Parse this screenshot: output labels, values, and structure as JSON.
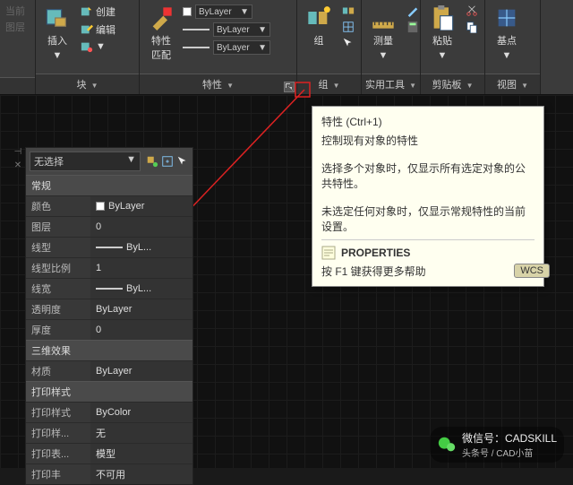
{
  "ribbon": {
    "panels": {
      "left": {
        "btn1": "当前",
        "btn2": "图层"
      },
      "block": {
        "title": "块",
        "insert": "插入",
        "create": "创建",
        "edit": "编辑"
      },
      "properties": {
        "title": "特性",
        "match": "特性\n匹配",
        "opt": "ByLayer"
      },
      "group": {
        "title": "组",
        "label": "组"
      },
      "utils": {
        "title": "实用工具",
        "measure": "测量"
      },
      "clipboard": {
        "title": "剪贴板",
        "paste": "粘贴"
      },
      "view": {
        "title": "视图",
        "base": "基点"
      }
    }
  },
  "tooltip": {
    "title": "特性 (Ctrl+1)",
    "line1": "控制现有对象的特性",
    "line2": "选择多个对象时，仅显示所有选定对象的公共特性。",
    "line3": "未选定任何对象时，仅显示常规特性的当前设置。",
    "cmd": "PROPERTIES",
    "help": "按 F1 键获得更多帮助"
  },
  "props": {
    "header": "无选择",
    "cat1": "常规",
    "rows": [
      {
        "k": "颜色",
        "v": "ByLayer",
        "color": true
      },
      {
        "k": "图层",
        "v": "0"
      },
      {
        "k": "线型",
        "v": "ByL...",
        "lt": true
      },
      {
        "k": "线型比例",
        "v": "1"
      },
      {
        "k": "线宽",
        "v": "ByL...",
        "lt": true
      },
      {
        "k": "透明度",
        "v": "ByLayer"
      },
      {
        "k": "厚度",
        "v": "0"
      }
    ],
    "cat2": "三维效果",
    "rows2": [
      {
        "k": "材质",
        "v": "ByLayer"
      }
    ],
    "cat3": "打印样式",
    "rows3": [
      {
        "k": "打印样式",
        "v": "ByColor"
      },
      {
        "k": "打印样...",
        "v": "无"
      },
      {
        "k": "打印表...",
        "v": "模型"
      },
      {
        "k": "打印丰",
        "v": "不可用"
      }
    ]
  },
  "wcs": "WCS",
  "watermark": {
    "line1": "微信号：CADSKILL",
    "line2": "头条号 / CAD小苗"
  }
}
